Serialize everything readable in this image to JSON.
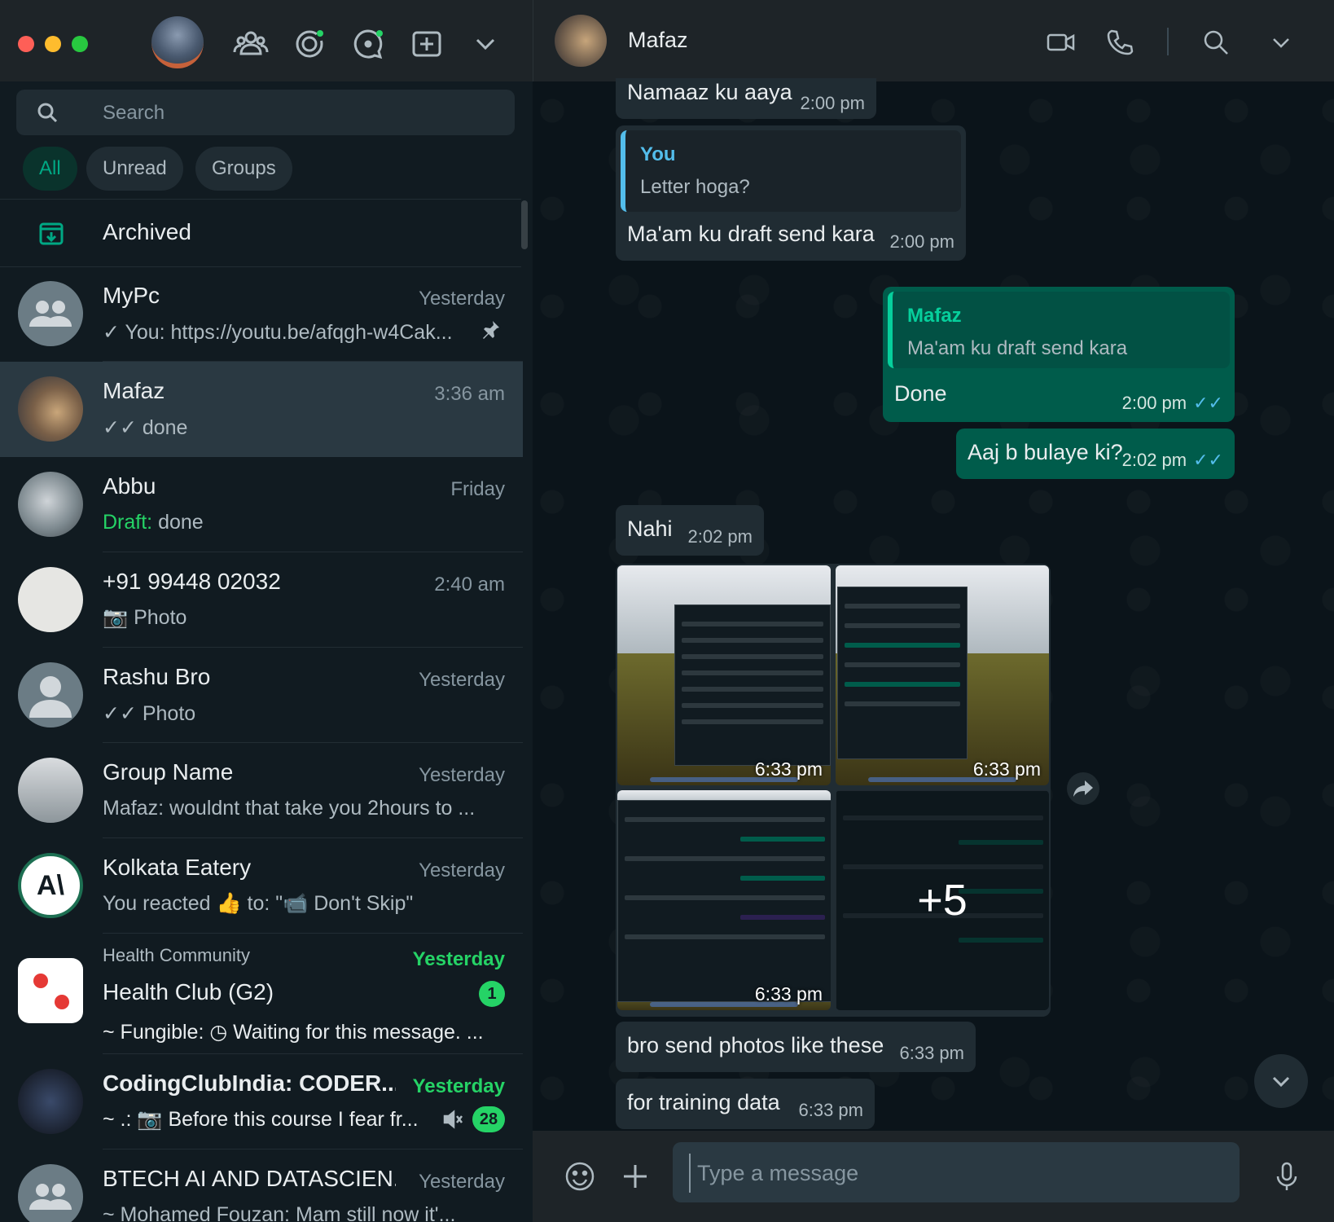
{
  "sidebar": {
    "search_placeholder": "Search",
    "filters": [
      "All",
      "Unread",
      "Groups"
    ],
    "archived_label": "Archived",
    "chats": [
      {
        "name": "MyPc",
        "time": "Yesterday",
        "preview": "✓ You: https://youtu.be/afqgh-w4Cak..."
      },
      {
        "name": "Mafaz",
        "time": "3:36 am",
        "preview": "✓✓ done"
      },
      {
        "name": "Abbu",
        "time": "Friday",
        "draft_label": "Draft:",
        "preview": "done"
      },
      {
        "name": "+91 99448 02032",
        "time": "2:40 am",
        "preview": "Photo"
      },
      {
        "name": "Rashu Bro",
        "time": "Yesterday",
        "preview": "✓✓ Photo"
      },
      {
        "name": "Group Name",
        "time": "Yesterday",
        "preview": "Mafaz: wouldnt that take you 2hours to ..."
      },
      {
        "name": "Kolkata Eatery",
        "time": "Yesterday",
        "preview": "You reacted 👍 to: \"📹 Don't Skip\""
      },
      {
        "community": "Health Community",
        "name": "Health Club (G2)",
        "time": "Yesterday",
        "preview": "~ Fungible: ◷ Waiting for this message. ...",
        "unread": "1"
      },
      {
        "name": "CodingClubIndia: CODER...",
        "time": "Yesterday",
        "preview": "~ .: 📷 Before this course I fear fr...",
        "unread": "28"
      },
      {
        "name": "BTECH AI AND DATASCIEN...",
        "time": "Yesterday",
        "preview": "~ Mohamed Fouzan: Mam still now it'..."
      }
    ]
  },
  "conversation": {
    "contact_name": "Mafaz",
    "messages": [
      {
        "text": "Namaaz ku aaya",
        "time": "2:00 pm"
      },
      {
        "quote_name": "You",
        "quote_text": "Letter hoga?",
        "text": "Ma'am ku draft send kara",
        "time": "2:00 pm"
      },
      {
        "quote_name": "Mafaz",
        "quote_text": "Ma'am ku draft send kara",
        "text": "Done",
        "time": "2:00 pm"
      },
      {
        "text": "Aaj b bulaye ki?",
        "time": "2:02 pm"
      },
      {
        "text": "Nahi",
        "time": "2:02 pm"
      },
      {
        "text": "bro send photos like these",
        "time": "6:33 pm"
      },
      {
        "text": "for training data",
        "time": "6:33 pm"
      }
    ],
    "photos": {
      "times": [
        "6:33 pm",
        "6:33 pm",
        "6:33 pm"
      ],
      "more_count": "+5"
    },
    "composer_placeholder": "Type a message"
  },
  "colors": {
    "accent": "#00a884",
    "outgoing_bubble": "#005c4b",
    "incoming_bubble": "#202c33",
    "read_ticks": "#53bdeb"
  }
}
